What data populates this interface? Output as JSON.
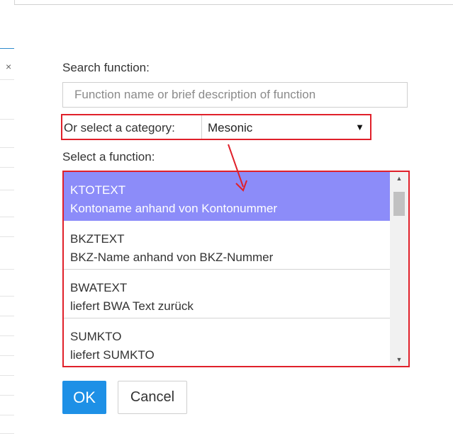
{
  "background": {
    "close_glyph": "×"
  },
  "dialog": {
    "search_label": "Search function:",
    "search_placeholder": "Function name or brief description of function",
    "search_value": "",
    "category_label": "Or select a category:",
    "category_value": "Mesonic",
    "category_arrow": "▼",
    "function_label": "Select a function:",
    "functions": [
      {
        "name": "KTOTEXT",
        "description": "Kontoname anhand von Kontonummer",
        "selected": true
      },
      {
        "name": "BKZTEXT",
        "description": "BKZ-Name anhand von BKZ-Nummer",
        "selected": false
      },
      {
        "name": "BWATEXT",
        "description": "liefert BWA Text zurück",
        "selected": false
      },
      {
        "name": "SUMKTO",
        "description": "liefert SUMKTO",
        "selected": false
      }
    ],
    "scroll_up": "▲",
    "scroll_down": "▼",
    "ok_label": "OK",
    "cancel_label": "Cancel"
  },
  "colors": {
    "highlight_border": "#e0202a",
    "selected_row": "#8c8cf9",
    "ok_button": "#1e90e6",
    "annotation_arrow": "#e0202a"
  },
  "icons": [
    "close-icon",
    "dropdown-arrow-icon",
    "scroll-up-icon",
    "scroll-down-icon",
    "annotation-arrow"
  ]
}
